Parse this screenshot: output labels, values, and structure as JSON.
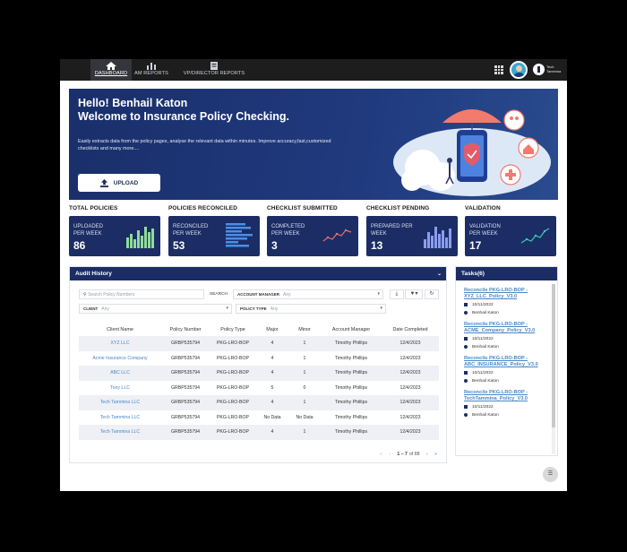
{
  "nav": {
    "tabs": [
      {
        "label": "DASHBOARD",
        "icon": "home-icon",
        "active": true
      },
      {
        "label": "AM REPORTS",
        "icon": "bar-chart-icon",
        "active": false
      },
      {
        "label": "VP/DIRECTOR REPORTS",
        "icon": "report-icon",
        "active": false
      }
    ],
    "brand_text": "Tech Tammina"
  },
  "hero": {
    "greeting": "Hello! Benhail Katon",
    "welcome": "Welcome to Insurance Policy Checking.",
    "description": "Easily extracts data from the policy pages, analyse the relevant data within minutes. Improve accuracy,fast,customized checklists and many more....",
    "upload_label": "UPLOAD"
  },
  "stats": [
    {
      "title": "TOTAL POLICIES",
      "label1": "UPLOADED",
      "label2": "PER WEEK",
      "value": "86",
      "chart": "bar-v",
      "chart_color": "#8fdc9a"
    },
    {
      "title": "POLICIES RECONCILED",
      "label1": "RECONCILED",
      "label2": "PER WEEK",
      "value": "53",
      "chart": "bar-h",
      "chart_color": "#4a8fe7"
    },
    {
      "title": "CHECKLIST SUBMITTED",
      "label1": "COMPLETED",
      "label2": "PER WEEK",
      "value": "3",
      "chart": "line",
      "chart_color": "#f06b6b"
    },
    {
      "title": "CHECKLIST PENDING",
      "label1": "PREPARED PER",
      "label2": "WEEK",
      "value": "13",
      "chart": "bar-v",
      "chart_color": "#8a9df0"
    },
    {
      "title": "VALIDATION",
      "label1": "VALIDATION",
      "label2": "PER WEEK",
      "value": "17",
      "chart": "line",
      "chart_color": "#3fc6b8"
    }
  ],
  "audit": {
    "title": "Audit History",
    "search_placeholder": "Search Policy Numbers",
    "search_label": "SEARCH",
    "account_manager_label": "ACCOUNT MANAGER",
    "client_label": "CLIENT",
    "policy_type_label": "POLICY TYPE",
    "any": "Any",
    "columns": [
      "Client Name",
      "Policy Number",
      "Policy Type",
      "Major",
      "Minor",
      "Account Manager",
      "Date Completed"
    ],
    "rows": [
      [
        "XYZ LLC",
        "GRBP535794",
        "PKG-LRO-BOP",
        "4",
        "1",
        "Timothy Phillips",
        "12/4/2023"
      ],
      [
        "Acme Insurance Company",
        "GRBP535794",
        "PKG-LRO-BOP",
        "4",
        "1",
        "Timothy Phillips",
        "12/4/2023"
      ],
      [
        "ABC LLC",
        "GRBP535794",
        "PKG-LRO-BOP",
        "4",
        "1",
        "Timothy Phillips",
        "12/4/2023"
      ],
      [
        "Tony LLC",
        "GRBP535794",
        "PKG-LRO-BOP",
        "5",
        "0",
        "Timothy Phillips",
        "12/4/2023"
      ],
      [
        "Tech Tammina LLC",
        "GRBP535794",
        "PKG-LRO-BOP",
        "4",
        "1",
        "Timothy Phillips",
        "12/4/2023"
      ],
      [
        "Tech Tammina LLC",
        "GRBP535794",
        "PKG-LRO-BOP",
        "No Data",
        "No Data",
        "Timothy Phillips",
        "12/4/2023"
      ],
      [
        "Tech Tammina LLC",
        "GRBP535794",
        "PKG-LRO-BOP",
        "4",
        "1",
        "Timothy Phillips",
        "12/4/2023"
      ]
    ],
    "pager": {
      "range": "1 – 7",
      "of_label": "of 88"
    }
  },
  "tasks": {
    "title": "Tasks(6)",
    "items": [
      {
        "title": "Reconcile PKG-LRO-BOP - XYZ_LLC_Policy_V3.0",
        "date": "10/11/2022",
        "user": "Benhail Katon"
      },
      {
        "title": "Reconcile PKG-LRO-BOP - ACME_Company_Policy_V3.0",
        "date": "10/11/2022",
        "user": "Benhail Katon"
      },
      {
        "title": "Reconcile PKG-LRO-BOP - ABC_INSURANCE_Policy_V3.0",
        "date": "10/11/2022",
        "user": "Benhail Katon"
      },
      {
        "title": "Reconcile PKG-LRO-BOP - TechTammina_Policy_V3.0",
        "date": "10/11/2022",
        "user": "Benhail Katon"
      }
    ]
  }
}
